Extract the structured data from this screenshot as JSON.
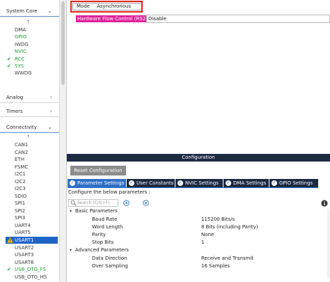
{
  "sidebar": {
    "system_core": {
      "label": "System Core",
      "chevron": "chevron-down-icon"
    },
    "system_core_items": [
      {
        "label": "DMA",
        "status": "none"
      },
      {
        "label": "GPIO",
        "status": "green"
      },
      {
        "label": "IWDG",
        "status": "none"
      },
      {
        "label": "NVIC",
        "status": "green"
      },
      {
        "label": "RCC",
        "status": "check"
      },
      {
        "label": "SYS",
        "status": "check"
      },
      {
        "label": "WWDG",
        "status": "none"
      }
    ],
    "analog": {
      "label": "Analog",
      "chevron": "chevron-right-icon"
    },
    "timers": {
      "label": "Timers",
      "chevron": "chevron-right-icon"
    },
    "connectivity": {
      "label": "Connectivity",
      "chevron": "chevron-down-icon"
    },
    "connectivity_items": [
      {
        "label": "CAN1",
        "status": "none"
      },
      {
        "label": "CAN2",
        "status": "none"
      },
      {
        "label": "ETH",
        "status": "none"
      },
      {
        "label": "FSMC",
        "status": "none"
      },
      {
        "label": "I2C1",
        "status": "none"
      },
      {
        "label": "I2C2",
        "status": "none"
      },
      {
        "label": "I2C3",
        "status": "none"
      },
      {
        "label": "SDIO",
        "status": "none"
      },
      {
        "label": "SPI1",
        "status": "none"
      },
      {
        "label": "SPI2",
        "status": "none"
      },
      {
        "label": "SPI3",
        "status": "none"
      },
      {
        "label": "UART4",
        "status": "none"
      },
      {
        "label": "UART5",
        "status": "none"
      },
      {
        "label": "USART1",
        "status": "warning-selected"
      },
      {
        "label": "USART2",
        "status": "none"
      },
      {
        "label": "USART3",
        "status": "none"
      },
      {
        "label": "USART6",
        "status": "none"
      },
      {
        "label": "USB_OTG_FS",
        "status": "check"
      },
      {
        "label": "USB_OTG_HS",
        "status": "none"
      }
    ]
  },
  "mode": {
    "mode_label": "Mode",
    "mode_value": "Asynchronous",
    "hfc_label": "Hardware Flow Control (RS232)",
    "hfc_value": "Disable"
  },
  "config": {
    "title": "Configuration",
    "reset_button": "Reset Configuration",
    "tabs": [
      {
        "label": "Parameter Settings",
        "active": true
      },
      {
        "label": "User Constants",
        "active": false
      },
      {
        "label": "NVIC Settings",
        "active": false
      },
      {
        "label": "DMA Settings",
        "active": false
      },
      {
        "label": "GPIO Settings",
        "active": false
      }
    ],
    "configure_text": "Configure the below parameters :",
    "search_placeholder": "Search (Crtl+F)",
    "groups": [
      {
        "name": "Basic Parameters",
        "params": [
          {
            "name": "Baud Rate",
            "value": "115200 Bits/s"
          },
          {
            "name": "Word Length",
            "value": "8 Bits (including Parity)"
          },
          {
            "name": "Parity",
            "value": "None"
          },
          {
            "name": "Stop Bits",
            "value": "1"
          }
        ]
      },
      {
        "name": "Advanced Parameters",
        "params": [
          {
            "name": "Data Direction",
            "value": "Receive and Transmit"
          },
          {
            "name": "Over Sampling",
            "value": "16 Samples"
          }
        ]
      }
    ]
  },
  "colors": {
    "selection_blue": "#1e64c8",
    "green_enabled": "#1e9e37",
    "config_navy": "#1d2a44",
    "active_tab_blue": "#2e6fc7",
    "highlight_red": "#e2231a",
    "highlight_magenta": "#e0209a"
  }
}
